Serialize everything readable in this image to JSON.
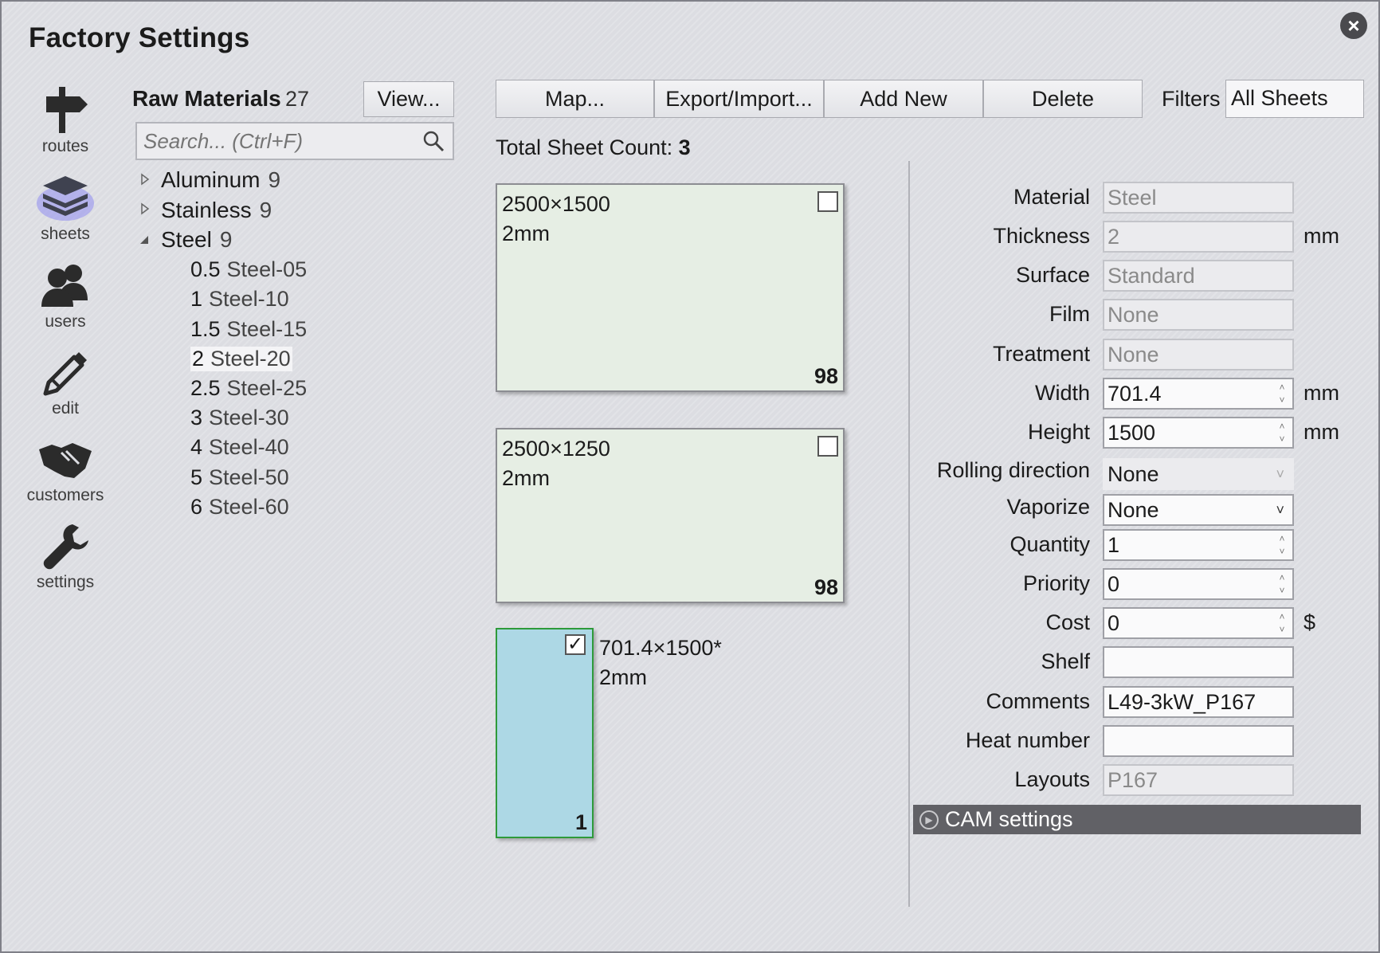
{
  "window": {
    "title": "Factory Settings",
    "close_icon": "close-icon"
  },
  "nav": [
    {
      "label": "routes",
      "icon": "signpost-icon",
      "active": false
    },
    {
      "label": "sheets",
      "icon": "layers-icon",
      "active": true
    },
    {
      "label": "users",
      "icon": "users-icon",
      "active": false
    },
    {
      "label": "edit",
      "icon": "pencil-icon",
      "active": false
    },
    {
      "label": "customers",
      "icon": "handshake-icon",
      "active": false
    },
    {
      "label": "settings",
      "icon": "wrench-icon",
      "active": false
    }
  ],
  "raw_materials": {
    "title": "Raw Materials",
    "count": "27",
    "view_button": "View...",
    "search_placeholder": "Search... (Ctrl+F)",
    "tree": [
      {
        "name": "Aluminum",
        "count": "9",
        "expanded": false
      },
      {
        "name": "Stainless",
        "count": "9",
        "expanded": false
      },
      {
        "name": "Steel",
        "count": "9",
        "expanded": true,
        "children": [
          {
            "thickness": "0.5",
            "name": "Steel-05"
          },
          {
            "thickness": "1",
            "name": "Steel-10"
          },
          {
            "thickness": "1.5",
            "name": "Steel-15"
          },
          {
            "thickness": "2",
            "name": "Steel-20",
            "selected": true
          },
          {
            "thickness": "2.5",
            "name": "Steel-25"
          },
          {
            "thickness": "3",
            "name": "Steel-30"
          },
          {
            "thickness": "4",
            "name": "Steel-40"
          },
          {
            "thickness": "5",
            "name": "Steel-50"
          },
          {
            "thickness": "6",
            "name": "Steel-60"
          }
        ]
      }
    ]
  },
  "toolbar": {
    "map": "Map...",
    "export_import": "Export/Import...",
    "add_new": "Add New",
    "delete": "Delete",
    "filters_label": "Filters",
    "filter_value": "All Sheets"
  },
  "sheets": {
    "count_label": "Total Sheet Count:",
    "count": "3",
    "items": [
      {
        "size": "2500×1500",
        "thickness": "2mm",
        "qty": "98",
        "checked": false
      },
      {
        "size": "2500×1250",
        "thickness": "2mm",
        "qty": "98",
        "checked": false
      },
      {
        "size": "701.4×1500*",
        "thickness": "2mm",
        "qty": "1",
        "checked": true
      }
    ]
  },
  "form": {
    "material": {
      "label": "Material",
      "value": "Steel"
    },
    "thickness": {
      "label": "Thickness",
      "value": "2",
      "unit": "mm"
    },
    "surface": {
      "label": "Surface",
      "value": "Standard"
    },
    "film": {
      "label": "Film",
      "value": "None"
    },
    "treatment": {
      "label": "Treatment",
      "value": "None"
    },
    "width": {
      "label": "Width",
      "value": "701.4",
      "unit": "mm"
    },
    "height": {
      "label": "Height",
      "value": "1500",
      "unit": "mm"
    },
    "rolling": {
      "label": "Rolling direction",
      "value": "None"
    },
    "vaporize": {
      "label": "Vaporize",
      "value": "None"
    },
    "quantity": {
      "label": "Quantity",
      "value": "1"
    },
    "priority": {
      "label": "Priority",
      "value": "0"
    },
    "cost": {
      "label": "Cost",
      "value": "0",
      "unit": "$"
    },
    "shelf": {
      "label": "Shelf",
      "value": ""
    },
    "comments": {
      "label": "Comments",
      "value": "L49-3kW_P167"
    },
    "heat_number": {
      "label": "Heat number",
      "value": ""
    },
    "layouts": {
      "label": "Layouts",
      "value": "P167"
    }
  },
  "cam": {
    "label": "CAM settings"
  }
}
